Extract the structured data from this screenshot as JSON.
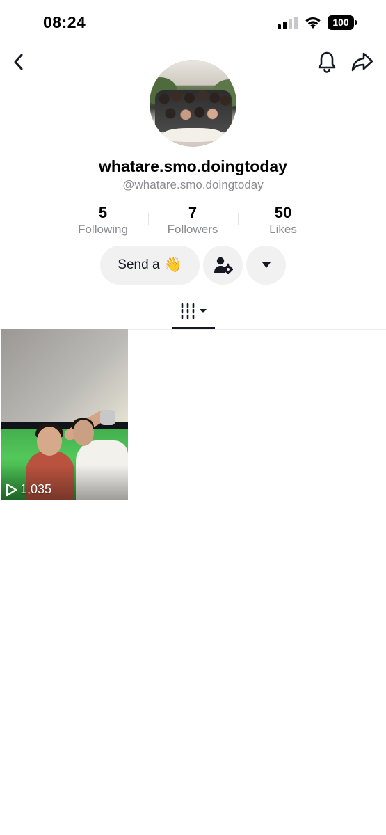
{
  "status_bar": {
    "time": "08:24",
    "battery": "100",
    "icons": [
      "cellular-signal-icon",
      "wifi-icon",
      "battery-icon"
    ]
  },
  "header": {
    "icons": [
      "back-chevron-icon",
      "bell-icon",
      "share-arrow-icon"
    ]
  },
  "profile": {
    "display_name": "whatare.smo.doingtoday",
    "handle": "@whatare.smo.doingtoday"
  },
  "stats": {
    "following": {
      "value": "5",
      "label": "Following"
    },
    "followers": {
      "value": "7",
      "label": "Followers"
    },
    "likes": {
      "value": "50",
      "label": "Likes"
    }
  },
  "actions": {
    "send_label": "Send a",
    "send_emoji": "👋",
    "icons": [
      "add-friend-icon",
      "dropdown-caret-icon"
    ]
  },
  "tabs": {
    "active": "videos",
    "icons": [
      "videos-grid-icon",
      "dropdown-caret-icon"
    ]
  },
  "videos": [
    {
      "views": "1,035",
      "icon": "play-icon"
    }
  ]
}
